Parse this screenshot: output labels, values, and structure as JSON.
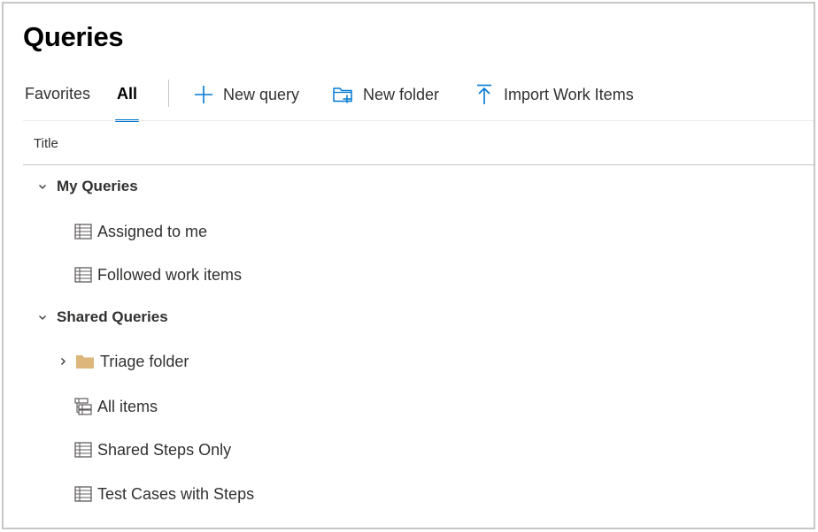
{
  "page": {
    "title": "Queries"
  },
  "tabs": [
    {
      "label": "Favorites",
      "selected": false
    },
    {
      "label": "All",
      "selected": true
    }
  ],
  "commands": [
    {
      "label": "New query",
      "icon": "plus-icon"
    },
    {
      "label": "New folder",
      "icon": "new-folder-icon"
    },
    {
      "label": "Import Work Items",
      "icon": "upload-arrow-icon"
    }
  ],
  "table": {
    "column_title": "Title"
  },
  "tree": {
    "my_queries": {
      "label": "My Queries",
      "expanded": true,
      "items": [
        {
          "label": "Assigned to me",
          "icon": "flat-list-query-icon"
        },
        {
          "label": "Followed work items",
          "icon": "flat-list-query-icon"
        }
      ]
    },
    "shared_queries": {
      "label": "Shared Queries",
      "expanded": true,
      "folder": {
        "label": "Triage folder",
        "icon": "folder-icon",
        "expanded": false
      },
      "items": [
        {
          "label": "All items",
          "icon": "tree-query-icon"
        },
        {
          "label": "Shared Steps Only",
          "icon": "flat-list-query-icon"
        },
        {
          "label": "Test Cases with Steps",
          "icon": "flat-list-query-icon"
        }
      ]
    }
  },
  "colors": {
    "accent": "#0078d4",
    "folder": "#dcb67a",
    "text": "#323130",
    "divider": "#c8c6c4"
  }
}
